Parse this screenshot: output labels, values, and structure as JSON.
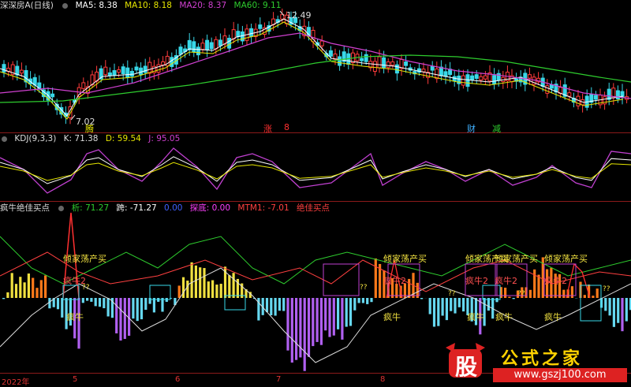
{
  "panel1": {
    "title": "深深房A(日线)",
    "ma": [
      {
        "label": "MA5: 8.38",
        "color": "#ffffff"
      },
      {
        "label": "MA10: 8.18",
        "color": "#e6e600"
      },
      {
        "label": "MA20: 8.37",
        "color": "#d040d0"
      },
      {
        "label": "MA60: 9.11",
        "color": "#2ecc2e"
      }
    ],
    "high_label": "12.49",
    "low_label": "7.02",
    "events": [
      {
        "label": "腾",
        "color": "#e6e600"
      },
      {
        "label": "涨",
        "color": "#ff3030"
      },
      {
        "label": "8",
        "color": "#ff3030"
      },
      {
        "label": "财",
        "color": "#40b0ff"
      },
      {
        "label": "减",
        "color": "#2ecc2e"
      }
    ]
  },
  "panel2": {
    "title": "KDJ(9,3,3)",
    "k": "K: 71.38",
    "d": "D: 59.54",
    "j": "J: 95.05"
  },
  "panel3": {
    "title": "疯牛绝佳买点",
    "items": [
      {
        "label": "析: 71.27",
        "color": "#2ecc2e"
      },
      {
        "label": "跨: -71.27",
        "color": "#ffffff"
      },
      {
        "label": "0.00",
        "color": "#4060ff"
      },
      {
        "label": "探底: 0.00",
        "color": "#ff40ff"
      },
      {
        "label": "MTM1: -7.01",
        "color": "#ff4040"
      },
      {
        "label": "绝佳买点",
        "color": "#ff4040"
      }
    ],
    "annotations": {
      "buy_text": "倾家荡产买",
      "crazy2": "疯牛2",
      "crazy": "疯牛",
      "q": "??"
    }
  },
  "xaxis": [
    "2022年",
    "5",
    "6",
    "7",
    "8"
  ],
  "watermark": {
    "char": "股",
    "name": "公式之家",
    "url": "www.gszj100.com"
  }
}
